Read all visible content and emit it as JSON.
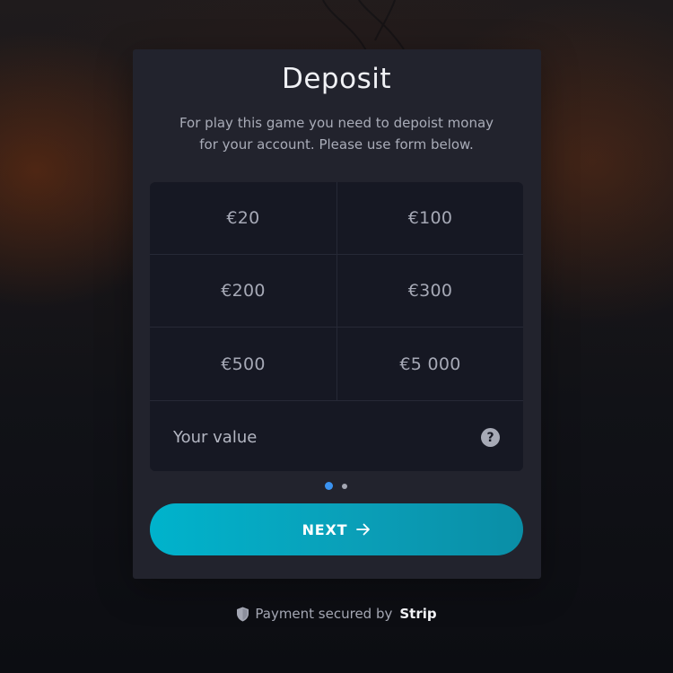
{
  "dialog": {
    "title": "Deposit",
    "description": "For play this game you need to depoist monay for your account. Please use form below."
  },
  "amounts": [
    "€20",
    "€100",
    "€200",
    "€300",
    "€500",
    "€5 000"
  ],
  "custom_amount": {
    "placeholder": "Your value",
    "help_icon": "question-circle-icon"
  },
  "pagination": {
    "current_page": 1,
    "total_pages": 2
  },
  "next_button": {
    "label": "NEXT",
    "icon": "arrow-right-icon"
  },
  "footer": {
    "text": "Payment secured by",
    "brand": "Strip",
    "icon": "shield-icon"
  },
  "colors": {
    "accent": "#00b3cc",
    "active_dot": "#3a92f0",
    "card_bg": "#22232d",
    "grid_bg": "#161823"
  }
}
